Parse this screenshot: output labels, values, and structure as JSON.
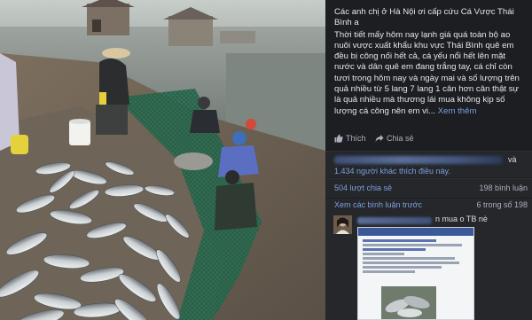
{
  "post": {
    "lines": [
      "Các anh chị ở Hà Nội ơi cấp cứu Cá Vược Thái Bình a",
      "Thời tiết mấy hôm nay lạnh giá quá toàn bộ ao nuôi vược xuất khẩu khu vực Thái Bình quê em đều bị công nối hết cả, cá yếu nổi hết lên mặt nước và dân quê em đang trắng tay, cá chỉ còn tươi trong hôm nay và ngày mai và số lượng trên quả nhiều từ 5 lang 7 lang 1 cân hơn cân thật sự là quả nhiều mà thương lái mua không kịp số lượng cá công nên em vi..."
    ],
    "see_more": "Xem thêm"
  },
  "actions": {
    "like": "Thích",
    "share": "Chia sẻ"
  },
  "reactions": {
    "trailing": "và",
    "likes_count": "1.434 người khác thích điều này."
  },
  "engagement": {
    "shares": "504 lượt chia sẻ",
    "comments": "198 bình luận",
    "view_previous": "Xem các bình luận trước",
    "previous_count": "6 trong số 198"
  },
  "comment": {
    "text": "n mua o TB nè"
  },
  "colors": {
    "panel_bg": "#1c1e21",
    "link": "#7d9fe0",
    "text": "#e4e6eb",
    "muted": "#aab0bc"
  }
}
